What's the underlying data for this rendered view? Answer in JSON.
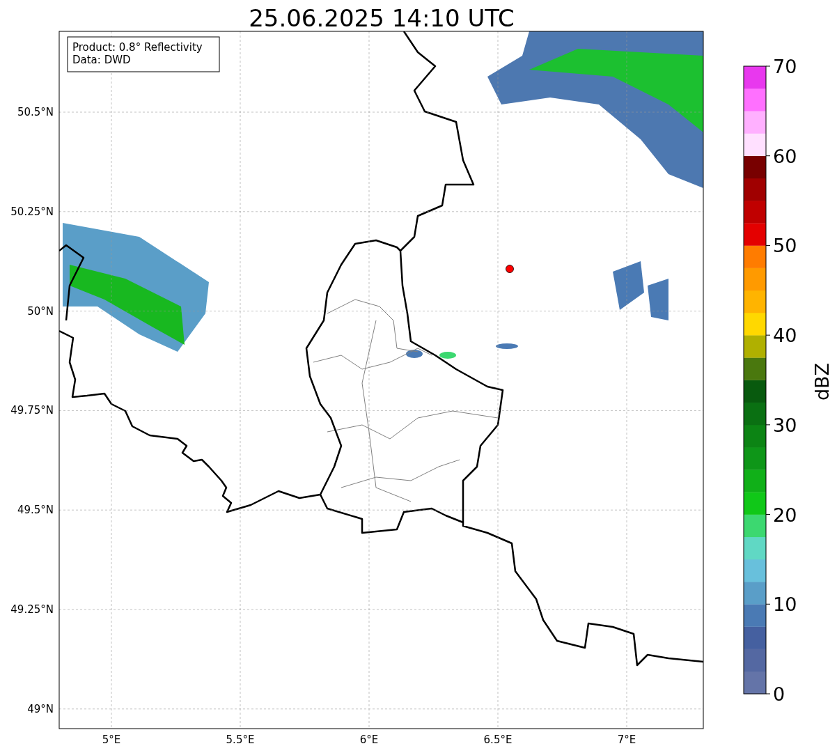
{
  "title": "25.06.2025 14:10 UTC",
  "info_box": [
    "Product: 0.8° Reflectivity",
    "Data: DWD"
  ],
  "y_axis": {
    "ticks": [
      "50.5°N",
      "50.25°N",
      "50°N",
      "49.75°N",
      "49.5°N",
      "49.25°N",
      "49°N"
    ]
  },
  "x_axis": {
    "ticks": [
      "5°E",
      "5.5°E",
      "6°E",
      "6.5°E",
      "7°E"
    ]
  },
  "colorbar": {
    "label": "dBZ",
    "ticks": [
      "70",
      "60",
      "50",
      "40",
      "30",
      "20",
      "10",
      "0"
    ],
    "segments": [
      {
        "color": "#6474a8"
      },
      {
        "color": "#5468a2"
      },
      {
        "color": "#4560a0"
      },
      {
        "color": "#4a7ab4"
      },
      {
        "color": "#5a9ec8"
      },
      {
        "color": "#68c0dc"
      },
      {
        "color": "#60d8c4"
      },
      {
        "color": "#3cd870"
      },
      {
        "color": "#10c818"
      },
      {
        "color": "#10b018"
      },
      {
        "color": "#0e9618"
      },
      {
        "color": "#0c8414"
      },
      {
        "color": "#0a7012"
      },
      {
        "color": "#085a0e"
      },
      {
        "color": "#4a780e"
      },
      {
        "color": "#b0b000"
      },
      {
        "color": "#ffd800"
      },
      {
        "color": "#ffb400"
      },
      {
        "color": "#ff9a00"
      },
      {
        "color": "#ff7c00"
      },
      {
        "color": "#e40000"
      },
      {
        "color": "#c00000"
      },
      {
        "color": "#a00000"
      },
      {
        "color": "#780000"
      },
      {
        "color": "#ffe0ff"
      },
      {
        "color": "#ffb0ff"
      },
      {
        "color": "#ff70ff"
      },
      {
        "color": "#e838ee"
      }
    ]
  }
}
